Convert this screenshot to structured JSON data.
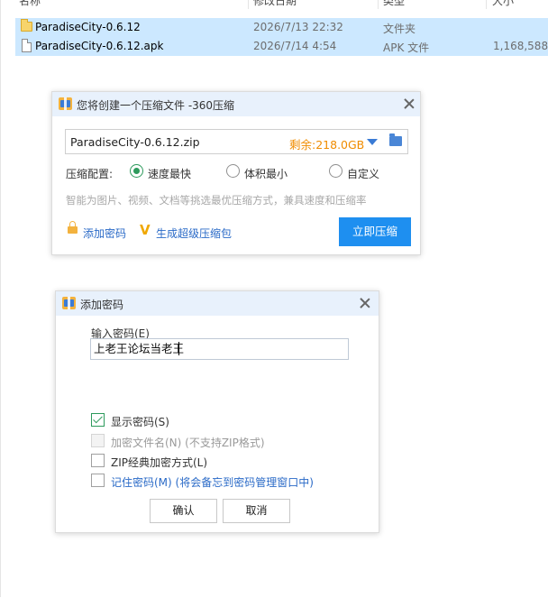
{
  "explorer": {
    "columns": {
      "name": "名称",
      "modified": "修改日期",
      "type": "类型",
      "size": "大小"
    },
    "files": [
      {
        "name": "ParadiseCity-0.6.12",
        "modified": "2026/7/13 22:32",
        "type": "文件夹",
        "size": "",
        "icon": "folder-icon"
      },
      {
        "name": "ParadiseCity-0.6.12.apk",
        "modified": "2026/7/14 4:54",
        "type": "APK 文件",
        "size": "1,168,588...",
        "icon": "file-icon"
      }
    ]
  },
  "compress_dialog": {
    "title": "您将创建一个压缩文件 -360压缩",
    "filename": "ParadiseCity-0.6.12.zip",
    "free_space": "剩余:218.0GB",
    "config_label": "压缩配置:",
    "options": [
      {
        "label": "速度最快",
        "checked": true
      },
      {
        "label": "体积最小",
        "checked": false
      },
      {
        "label": "自定义",
        "checked": false
      }
    ],
    "hint": "智能为图片、视频、文档等挑选最优压缩方式，兼具速度和压缩率",
    "add_password": "添加密码",
    "super_pack": "生成超级压缩包",
    "compress_button": "立即压缩"
  },
  "password_dialog": {
    "title": "添加密码",
    "input_label": "输入密码(E)",
    "password_value": "上老王论坛当老王",
    "checkboxes": [
      {
        "label": "显示密码(S)",
        "checked": true,
        "disabled": false
      },
      {
        "label": "加密文件名(N) (不支持ZIP格式)",
        "checked": false,
        "disabled": true
      },
      {
        "label": "ZIP经典加密方式(L)",
        "checked": false,
        "disabled": false
      },
      {
        "label": "记住密码(M) (将会备忘到密码管理窗口中)",
        "checked": false,
        "disabled": false
      }
    ],
    "ok_button": "确认",
    "cancel_button": "取消"
  },
  "colors": {
    "selection": "#cce8ff",
    "titlebar": "#e8f1fc",
    "accent_blue": "#1e8ff0",
    "link_blue": "#2a6ac7",
    "radio_green": "#2d9a5c",
    "space_orange": "#f08c00"
  }
}
